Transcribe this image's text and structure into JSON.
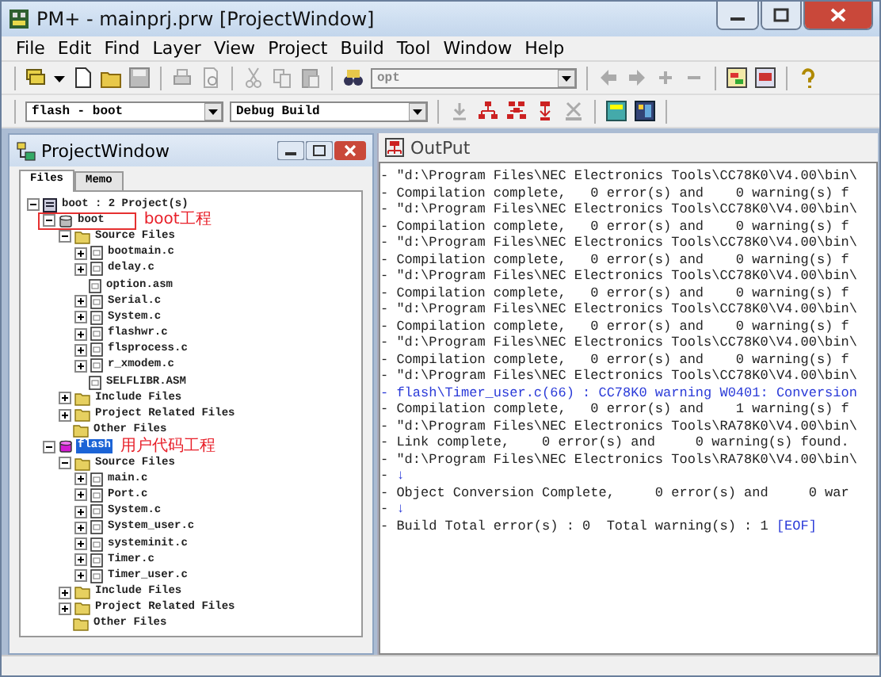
{
  "window": {
    "title": "PM+ - mainprj.prw [ProjectWindow]"
  },
  "menu": [
    "File",
    "Edit",
    "Find",
    "Layer",
    "View",
    "Project",
    "Build",
    "Tool",
    "Window",
    "Help"
  ],
  "toolbar": {
    "search": {
      "value": "opt"
    },
    "project_select": {
      "value": "flash - boot"
    },
    "build_select": {
      "value": "Debug Build"
    }
  },
  "project_window": {
    "title": "ProjectWindow",
    "tabs": [
      {
        "label": "Files",
        "selected": true
      },
      {
        "label": "Memo",
        "selected": false
      }
    ],
    "tree": [
      {
        "label": "boot : 2 Project(s)",
        "kind": "root",
        "expandable": true,
        "expanded": true,
        "selected": false,
        "children": [
          {
            "label": "boot",
            "kind": "project",
            "expandable": true,
            "expanded": true,
            "selected": false,
            "boxed": true,
            "annotation": "boot工程",
            "children": [
              {
                "label": "Source Files",
                "kind": "folder",
                "expandable": true,
                "expanded": true,
                "selected": false,
                "children": [
                  {
                    "label": "bootmain.c",
                    "kind": "file",
                    "expandable": true,
                    "expanded": false,
                    "selected": false
                  },
                  {
                    "label": "delay.c",
                    "kind": "file",
                    "expandable": true,
                    "expanded": false,
                    "selected": false
                  },
                  {
                    "label": "option.asm",
                    "kind": "file",
                    "expandable": false,
                    "selected": false
                  },
                  {
                    "label": "Serial.c",
                    "kind": "file",
                    "expandable": true,
                    "expanded": false,
                    "selected": false
                  },
                  {
                    "label": "System.c",
                    "kind": "file",
                    "expandable": true,
                    "expanded": false,
                    "selected": false
                  },
                  {
                    "label": "flashwr.c",
                    "kind": "file",
                    "expandable": true,
                    "expanded": false,
                    "selected": false
                  },
                  {
                    "label": "flsprocess.c",
                    "kind": "file",
                    "expandable": true,
                    "expanded": false,
                    "selected": false
                  },
                  {
                    "label": "r_xmodem.c",
                    "kind": "file",
                    "expandable": true,
                    "expanded": false,
                    "selected": false
                  },
                  {
                    "label": "SELFLIBR.ASM",
                    "kind": "file",
                    "expandable": false,
                    "selected": false
                  }
                ]
              },
              {
                "label": "Include Files",
                "kind": "folder",
                "expandable": true,
                "expanded": false,
                "selected": false
              },
              {
                "label": "Project Related Files",
                "kind": "folder",
                "expandable": true,
                "expanded": false,
                "selected": false
              },
              {
                "label": "Other Files",
                "kind": "folder",
                "expandable": false,
                "selected": false
              }
            ]
          },
          {
            "label": "flash",
            "kind": "project",
            "expandable": true,
            "expanded": true,
            "selected": true,
            "boxed": false,
            "annotation": "用户代码工程",
            "children": [
              {
                "label": "Source Files",
                "kind": "folder",
                "expandable": true,
                "expanded": true,
                "selected": false,
                "children": [
                  {
                    "label": "main.c",
                    "kind": "file",
                    "expandable": true,
                    "expanded": false,
                    "selected": false
                  },
                  {
                    "label": "Port.c",
                    "kind": "file",
                    "expandable": true,
                    "expanded": false,
                    "selected": false
                  },
                  {
                    "label": "System.c",
                    "kind": "file",
                    "expandable": true,
                    "expanded": false,
                    "selected": false
                  },
                  {
                    "label": "System_user.c",
                    "kind": "file",
                    "expandable": true,
                    "expanded": false,
                    "selected": false
                  },
                  {
                    "label": "systeminit.c",
                    "kind": "file",
                    "expandable": true,
                    "expanded": false,
                    "selected": false
                  },
                  {
                    "label": "Timer.c",
                    "kind": "file",
                    "expandable": true,
                    "expanded": false,
                    "selected": false
                  },
                  {
                    "label": "Timer_user.c",
                    "kind": "file",
                    "expandable": true,
                    "expanded": false,
                    "selected": false
                  }
                ]
              },
              {
                "label": "Include Files",
                "kind": "folder",
                "expandable": true,
                "expanded": false,
                "selected": false
              },
              {
                "label": "Project Related Files",
                "kind": "folder",
                "expandable": true,
                "expanded": false,
                "selected": false
              },
              {
                "label": "Other Files",
                "kind": "folder",
                "expandable": false,
                "selected": false
              }
            ]
          }
        ]
      }
    ]
  },
  "output": {
    "title": "OutPut",
    "lines": [
      {
        "kind": "normal",
        "text": "- \"d:\\Program Files\\NEC Electronics Tools\\CC78K0\\V4.00\\bin\\"
      },
      {
        "kind": "normal",
        "text": "- Compilation complete,   0 error(s) and    0 warning(s) f"
      },
      {
        "kind": "normal",
        "text": "- \"d:\\Program Files\\NEC Electronics Tools\\CC78K0\\V4.00\\bin\\"
      },
      {
        "kind": "normal",
        "text": "- Compilation complete,   0 error(s) and    0 warning(s) f"
      },
      {
        "kind": "normal",
        "text": "- \"d:\\Program Files\\NEC Electronics Tools\\CC78K0\\V4.00\\bin\\"
      },
      {
        "kind": "normal",
        "text": "- Compilation complete,   0 error(s) and    0 warning(s) f"
      },
      {
        "kind": "normal",
        "text": "- \"d:\\Program Files\\NEC Electronics Tools\\CC78K0\\V4.00\\bin\\"
      },
      {
        "kind": "normal",
        "text": "- Compilation complete,   0 error(s) and    0 warning(s) f"
      },
      {
        "kind": "normal",
        "text": "- \"d:\\Program Files\\NEC Electronics Tools\\CC78K0\\V4.00\\bin\\"
      },
      {
        "kind": "normal",
        "text": "- Compilation complete,   0 error(s) and    0 warning(s) f"
      },
      {
        "kind": "normal",
        "text": "- \"d:\\Program Files\\NEC Electronics Tools\\CC78K0\\V4.00\\bin\\"
      },
      {
        "kind": "normal",
        "text": "- Compilation complete,   0 error(s) and    0 warning(s) f"
      },
      {
        "kind": "normal",
        "text": "- \"d:\\Program Files\\NEC Electronics Tools\\CC78K0\\V4.00\\bin\\"
      },
      {
        "kind": "warning",
        "text": "- flash\\Timer_user.c(66) : CC78K0 warning W0401: Conversion"
      },
      {
        "kind": "normal",
        "text": "- Compilation complete,   0 error(s) and    1 warning(s) f"
      },
      {
        "kind": "normal",
        "text": "- \"d:\\Program Files\\NEC Electronics Tools\\RA78K0\\V4.00\\bin\\"
      },
      {
        "kind": "normal",
        "text": "- Link complete,    0 error(s) and     0 warning(s) found."
      },
      {
        "kind": "normal",
        "text": "- \"d:\\Program Files\\NEC Electronics Tools\\RA78K0\\V4.00\\bin\\"
      },
      {
        "kind": "normal",
        "text": "-",
        "tail": "↓"
      },
      {
        "kind": "normal",
        "text": "- Object Conversion Complete,     0 error(s) and     0 war"
      },
      {
        "kind": "normal",
        "text": "-",
        "tail": "↓"
      },
      {
        "kind": "normal",
        "text": "- Build Total error(s) : 0  Total warning(s) : 1",
        "tail": "[EOF]"
      }
    ]
  }
}
